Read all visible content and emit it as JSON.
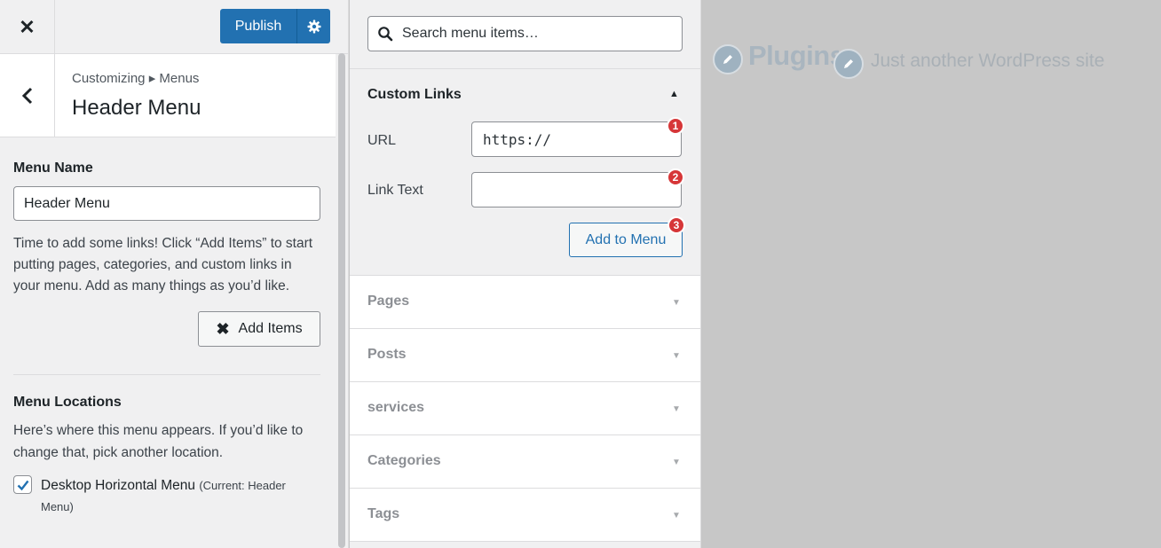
{
  "topbar": {
    "close_icon": "close-icon",
    "publish_label": "Publish",
    "settings_icon": "gear-icon"
  },
  "section_header": {
    "back_icon": "chevron-left-icon",
    "breadcrumb": "Customizing ▸ Menus",
    "title": "Header Menu"
  },
  "menu_settings": {
    "name_label": "Menu Name",
    "name_value": "Header Menu",
    "help_text": "Time to add some links! Click “Add Items” to start putting pages, categories, and custom links in your menu. Add as many things as you’d like.",
    "add_items_label": "Add Items",
    "locations_label": "Menu Locations",
    "locations_help": "Here’s where this menu appears. If you’d like to change that, pick another location.",
    "location_item": {
      "label": "Desktop Horizontal Menu",
      "current": "(Current: Header Menu)",
      "checked": true
    }
  },
  "items_panel": {
    "search_placeholder": "Search menu items…",
    "custom_links": {
      "title": "Custom Links",
      "url_label": "URL",
      "url_value": "https://",
      "link_text_label": "Link Text",
      "link_text_value": "",
      "add_button": "Add to Menu",
      "badges": [
        "1",
        "2",
        "3"
      ]
    },
    "sections": [
      {
        "label": "Pages"
      },
      {
        "label": "Posts"
      },
      {
        "label": "services"
      },
      {
        "label": "Categories"
      },
      {
        "label": "Tags"
      }
    ]
  },
  "preview": {
    "site_title": "Plugins",
    "tagline": "Just another WordPress site"
  },
  "colors": {
    "accent": "#2271b1",
    "badge": "#d63638",
    "panel_bg": "#f0f0f1",
    "preview_bg": "#c7c7c7"
  }
}
